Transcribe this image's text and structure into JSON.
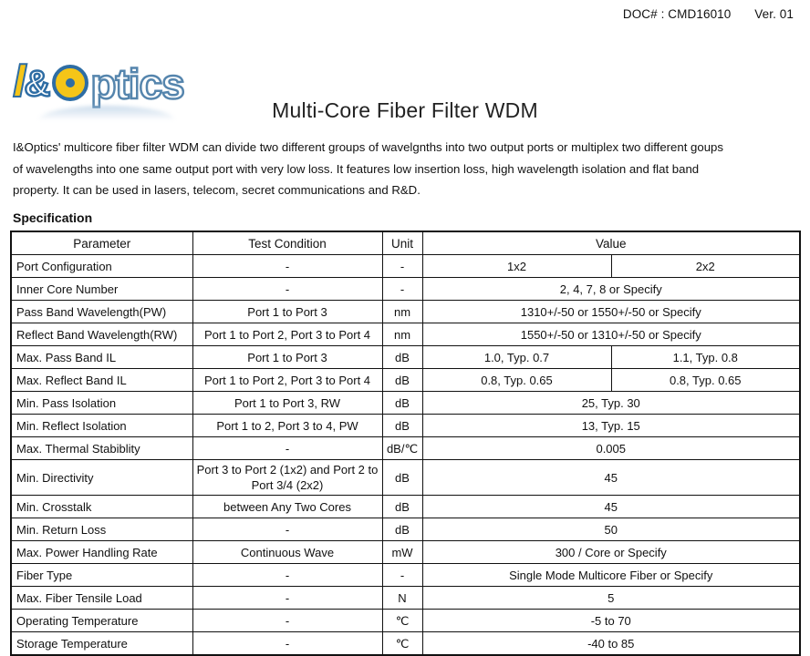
{
  "header": {
    "doc_number": "DOC# : CMD16010",
    "version": "Ver. 01"
  },
  "logo": {
    "letter_i": "I",
    "ampersand": "&",
    "word": "ptics",
    "full_text": "I&Optics",
    "colors": {
      "yellow": "#F5C518",
      "blue": "#2E6DA4",
      "outline_blue": "#5585AD"
    }
  },
  "title": "Multi-Core Fiber Filter WDM",
  "description": [
    "I&Optics' multicore fiber filter WDM can divide two different groups of wavelgnths into two output ports or multiplex two different goups",
    "of wavelengths into one same output port with very low loss. It features low insertion loss, high wavelength isolation and flat band",
    "property. It can be used in lasers, telecom, secret communications and R&D."
  ],
  "spec_label": "Specification",
  "table": {
    "columns": [
      "Parameter",
      "Test Condition",
      "Unit",
      "Value"
    ],
    "rows": [
      {
        "parameter": "Port Configuration",
        "condition": "-",
        "unit": "-",
        "value_left": "1x2",
        "value_right": "2x2",
        "split": true
      },
      {
        "parameter": "Inner Core Number",
        "condition": "-",
        "unit": "-",
        "value": "2, 4, 7, 8 or Specify",
        "split": false
      },
      {
        "parameter": "Pass Band Wavelength(PW)",
        "condition": "Port 1 to Port 3",
        "unit": "nm",
        "value": "1310+/-50 or 1550+/-50 or Specify",
        "split": false
      },
      {
        "parameter": "Reflect Band Wavelength(RW)",
        "condition": "Port 1 to Port 2, Port 3 to Port 4",
        "unit": "nm",
        "value": "1550+/-50 or 1310+/-50 or Specify",
        "split": false
      },
      {
        "parameter": "Max. Pass Band IL",
        "condition": "Port 1 to Port 3",
        "unit": "dB",
        "value_left": "1.0, Typ. 0.7",
        "value_right": "1.1, Typ. 0.8",
        "split": true
      },
      {
        "parameter": "Max. Reflect Band IL",
        "condition": "Port 1 to Port 2, Port 3 to Port 4",
        "unit": "dB",
        "value_left": "0.8, Typ. 0.65",
        "value_right": "0.8, Typ. 0.65",
        "split": true
      },
      {
        "parameter": "Min. Pass Isolation",
        "condition": "Port 1 to Port 3, RW",
        "unit": "dB",
        "value": "25, Typ. 30",
        "split": false
      },
      {
        "parameter": "Min. Reflect Isolation",
        "condition": "Port 1 to 2, Port 3 to 4, PW",
        "unit": "dB",
        "value": "13, Typ. 15",
        "split": false
      },
      {
        "parameter": "Max. Thermal Stabiblity",
        "condition": "-",
        "unit": "dB/℃",
        "value": "0.005",
        "split": false
      },
      {
        "parameter": "Min. Directivity",
        "condition": "Port 3 to Port 2 (1x2) and Port 2 to Port 3/4 (2x2)",
        "unit": "dB",
        "value": "45",
        "split": false,
        "tall": true
      },
      {
        "parameter": "Min. Crosstalk",
        "condition": "between Any Two Cores",
        "unit": "dB",
        "value": "45",
        "split": false
      },
      {
        "parameter": "Min. Return Loss",
        "condition": "-",
        "unit": "dB",
        "value": "50",
        "split": false
      },
      {
        "parameter": "Max. Power Handling Rate",
        "condition": "Continuous Wave",
        "unit": "mW",
        "value": "300 / Core or Specify",
        "split": false
      },
      {
        "parameter": "Fiber Type",
        "condition": "-",
        "unit": "-",
        "value": "Single Mode Multicore Fiber or Specify",
        "split": false
      },
      {
        "parameter": "Max. Fiber Tensile Load",
        "condition": "-",
        "unit": "N",
        "value": "5",
        "split": false
      },
      {
        "parameter": "Operating Temperature",
        "condition": "-",
        "unit": "℃",
        "value": "-5 to 70",
        "split": false
      },
      {
        "parameter": "Storage Temperature",
        "condition": "-",
        "unit": "℃",
        "value": "-40 to 85",
        "split": false
      }
    ]
  }
}
